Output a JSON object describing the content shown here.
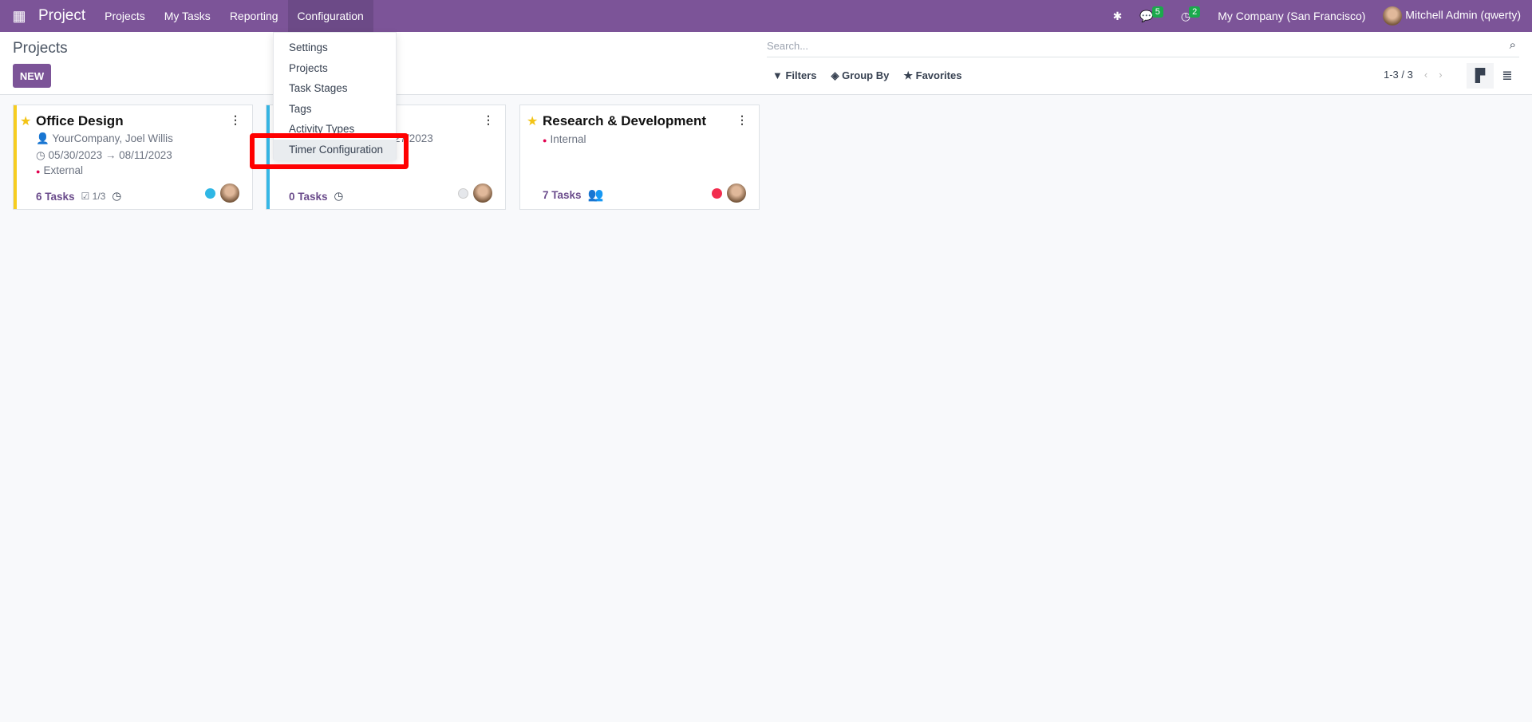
{
  "navbar": {
    "apps_icon": "grid-icon",
    "brand": "Project",
    "menu": [
      "Projects",
      "My Tasks",
      "Reporting",
      "Configuration"
    ],
    "messages_count": "5",
    "activities_count": "2",
    "company": "My Company (San Francisco)",
    "user": "Mitchell Admin (qwerty)",
    "color": "#7c5498"
  },
  "control_panel": {
    "title": "Projects",
    "new_label": "NEW",
    "search_placeholder": "Search...",
    "filters": "Filters",
    "group_by": "Group By",
    "favorites": "Favorites",
    "pager": "1-3 / 3"
  },
  "dropdown": {
    "items": [
      "Settings",
      "Projects",
      "Task Stages",
      "Tags",
      "Activity Types",
      "Timer Configuration"
    ],
    "highlighted": "Timer Configuration"
  },
  "cards": [
    {
      "name": "Office Design",
      "customer": "YourCompany, Joel Willis",
      "date_start": "05/30/2023",
      "date_end": "08/11/2023",
      "tag": "External",
      "tasks": "6 Tasks",
      "milestones": "1/3",
      "status_color": "#2fb7e5",
      "bar_color": "#f7cd1f",
      "favorite": true
    },
    {
      "date_partial": "27/2023",
      "tasks": "0 Tasks",
      "status_color": "#e5e7eb",
      "bar_color": "#36b7e6"
    },
    {
      "name": "Research & Development",
      "tag": "Internal",
      "tasks": "7 Tasks",
      "status_color": "#f22d4e",
      "favorite": true
    }
  ]
}
